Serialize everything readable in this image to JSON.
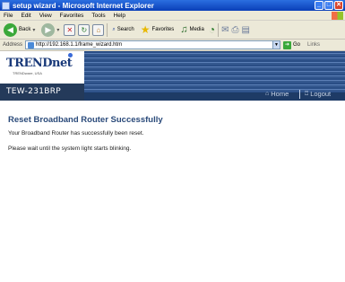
{
  "window": {
    "title": "setup wizard - Microsoft Internet Explorer",
    "buttons": {
      "minimize": "_",
      "maximize": "□",
      "close": "✕"
    }
  },
  "menu": [
    "File",
    "Edit",
    "View",
    "Favorites",
    "Tools",
    "Help"
  ],
  "toolbar": {
    "back_label": "Back",
    "search_label": "Search",
    "favorites_label": "Favorites",
    "media_label": "Media"
  },
  "address": {
    "label": "Address",
    "url": "http://192.168.1.1/frame_wizard.htm",
    "go_label": "Go",
    "links_label": "Links"
  },
  "header": {
    "logo_text": "TRENDnet",
    "logo_sub": "TRENDware, USA",
    "model": "TEW-231BRP",
    "nav_home": "Home",
    "nav_logout": "Logout"
  },
  "content": {
    "title": "Reset Broadband Router Successfully",
    "message1": "Your Broadband Router has successfully been reset.",
    "message2": "Please wait until the system light starts blinking."
  },
  "colors": {
    "title_text": "#2a4a7a",
    "header_band": "#2a4e86",
    "model_bg": "#243a5a"
  }
}
